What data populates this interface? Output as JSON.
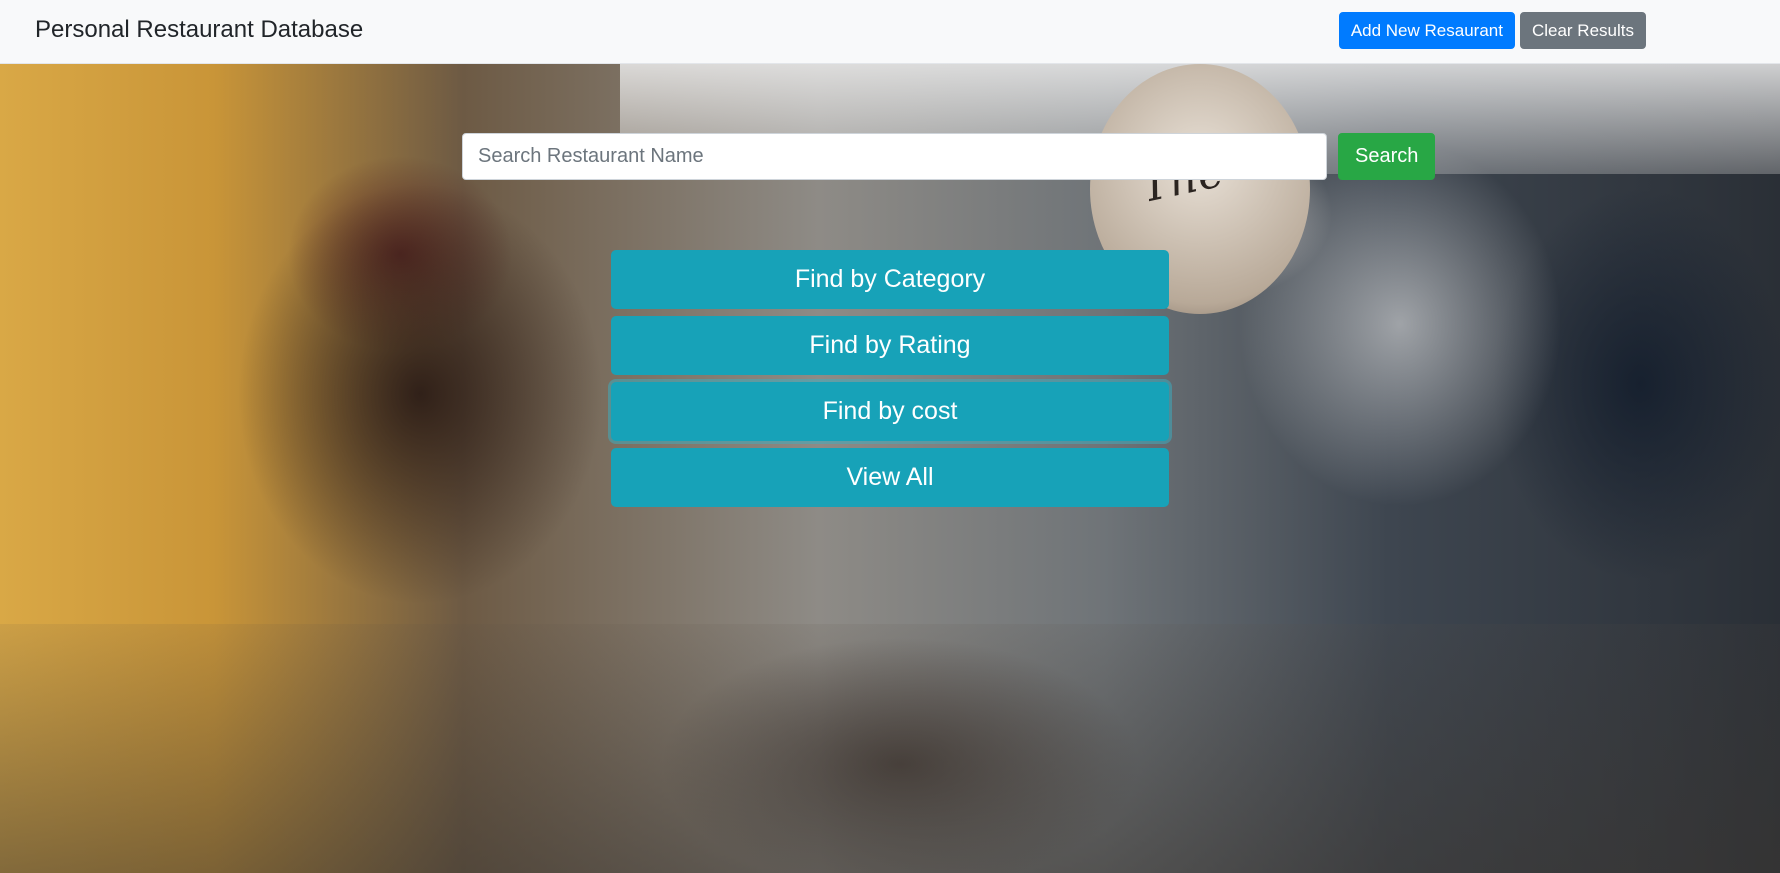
{
  "navbar": {
    "brand": "Personal Restaurant Database",
    "add_button": "Add New Resaurant",
    "clear_button": "Clear Results"
  },
  "hero": {
    "sign_text": "The"
  },
  "search": {
    "placeholder": "Search Restaurant Name",
    "value": "",
    "button": "Search"
  },
  "filters": [
    {
      "label": "Find by Category"
    },
    {
      "label": "Find by Rating"
    },
    {
      "label": "Find by cost"
    },
    {
      "label": "View All"
    }
  ],
  "colors": {
    "primary": "#007bff",
    "secondary": "#6c757d",
    "success": "#28a745",
    "info": "#17a2b8",
    "navbar_bg": "#f8f9fa"
  }
}
